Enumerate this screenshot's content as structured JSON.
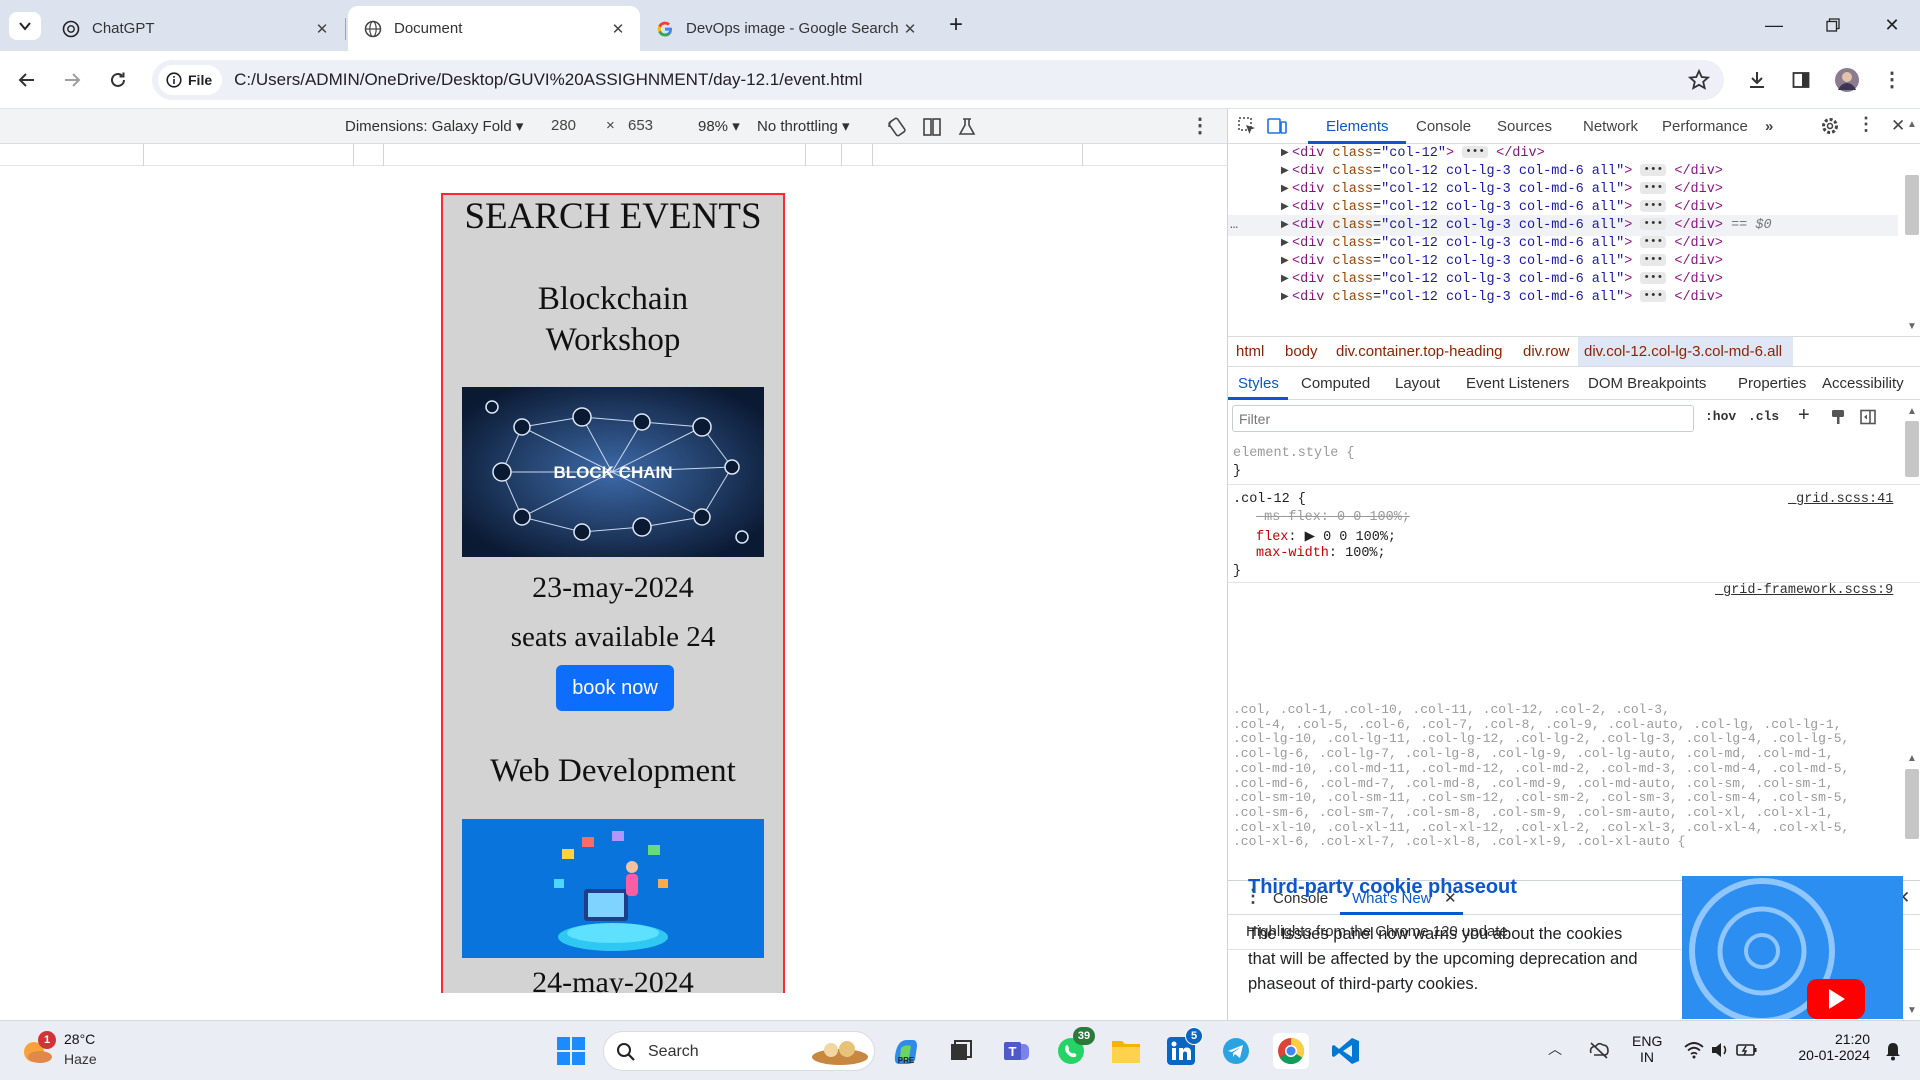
{
  "tabs": [
    {
      "title": "ChatGPT",
      "active": false
    },
    {
      "title": "Document",
      "active": true
    },
    {
      "title": "DevOps image - Google Search",
      "active": false
    }
  ],
  "toolbar": {
    "site_label": "File",
    "url": "C:/Users/ADMIN/OneDrive/Desktop/GUVI%20ASSIGHNMENT/day-12.1/event.html"
  },
  "device_toolbar": {
    "dimensions": "Dimensions: Galaxy Fold",
    "width": "280",
    "times": "×",
    "height": "653",
    "zoom": "98%",
    "throttling": "No throttling"
  },
  "page": {
    "heading": "SEARCH EVENTS",
    "events": [
      {
        "title_line1": "Blockchain",
        "title_line2": "Workshop",
        "image_text": "BLOCK CHAIN",
        "date": "23-may-2024",
        "seats": "seats available 24",
        "button": "book now"
      },
      {
        "title_line1": "Web Development",
        "date": "24-may-2024"
      }
    ]
  },
  "devtools": {
    "tabs": [
      "Elements",
      "Console",
      "Sources",
      "Network",
      "Performance"
    ],
    "active_tab": "Elements",
    "dom_lines": [
      {
        "cls": "col-12",
        "suffix": ""
      },
      {
        "cls": "col-12 col-lg-3 col-md-6 all",
        "suffix": ""
      },
      {
        "cls": "col-12 col-lg-3 col-md-6 all",
        "suffix": ""
      },
      {
        "cls": "col-12 col-lg-3 col-md-6 all",
        "suffix": ""
      },
      {
        "cls": "col-12 col-lg-3 col-md-6 all",
        "suffix": "== $0"
      },
      {
        "cls": "col-12 col-lg-3 col-md-6 all",
        "suffix": ""
      },
      {
        "cls": "col-12 col-lg-3 col-md-6 all",
        "suffix": ""
      },
      {
        "cls": "col-12 col-lg-3 col-md-6 all",
        "suffix": ""
      },
      {
        "cls": "col-12 col-lg-3 col-md-6 all",
        "suffix": ""
      }
    ],
    "breadcrumbs": [
      "html",
      "body",
      "div.container.top-heading",
      "div.row",
      "div.col-12.col-lg-3.col-md-6.all"
    ],
    "subtabs": [
      "Styles",
      "Computed",
      "Layout",
      "Event Listeners",
      "DOM Breakpoints",
      "Properties",
      "Accessibility"
    ],
    "filter_placeholder": "Filter",
    "hov": ":hov",
    "cls": ".cls",
    "styles": {
      "element_style": "element.style {",
      "close": "}",
      "rule_selector": ".col-12 {",
      "rule_source": "_grid.scss:41",
      "ms_flex": "-ms-flex: 0 0 100%;",
      "flex_name": "flex",
      "flex_val": "0 0 100%;",
      "maxw_name": "max-width",
      "maxw_val": "100%;",
      "grid_source": "_grid-framework.scss:9",
      "selector_lines": [
        ".col, .col-1, .col-10, .col-11, .col-12, .col-2, .col-3,",
        ".col-4, .col-5, .col-6, .col-7, .col-8, .col-9, .col-auto, .col-lg, .col-lg-1,",
        ".col-lg-10, .col-lg-11, .col-lg-12, .col-lg-2, .col-lg-3, .col-lg-4, .col-lg-5,",
        ".col-lg-6, .col-lg-7, .col-lg-8, .col-lg-9, .col-lg-auto, .col-md, .col-md-1,",
        ".col-md-10, .col-md-11, .col-md-12, .col-md-2, .col-md-3, .col-md-4, .col-md-5,",
        ".col-md-6, .col-md-7, .col-md-8, .col-md-9, .col-md-auto, .col-sm, .col-sm-1,",
        ".col-sm-10, .col-sm-11, .col-sm-12, .col-sm-2, .col-sm-3, .col-sm-4, .col-sm-5,",
        ".col-sm-6, .col-sm-7, .col-sm-8, .col-sm-9, .col-sm-auto, .col-xl, .col-xl-1,",
        ".col-xl-10, .col-xl-11, .col-xl-12, .col-xl-2, .col-xl-3, .col-xl-4, .col-xl-5,",
        ".col-xl-6, .col-xl-7, .col-xl-8, .col-xl-9, .col-xl-auto {"
      ]
    },
    "drawer": {
      "tabs": [
        "Console",
        "What's New"
      ],
      "highlights": "Highlights from the Chrome 120 update",
      "article_title": "Third-party cookie phaseout",
      "article_body": "The Issues panel now warns you about the cookies that will be affected by the upcoming deprecation and phaseout of third-party cookies."
    }
  },
  "taskbar": {
    "weather_temp": "28°C",
    "weather_desc": "Haze",
    "weather_badge": "1",
    "search": "Search",
    "whatsapp_badge": "39",
    "linkedin_badge": "5",
    "lang": "ENG",
    "region": "IN",
    "time": "21:20",
    "date": "20-01-2024"
  },
  "colors": {
    "accent": "#0b57d0",
    "button": "#0d6efd",
    "page_bg": "#d3d3d3",
    "page_border": "#ff2a2a"
  }
}
